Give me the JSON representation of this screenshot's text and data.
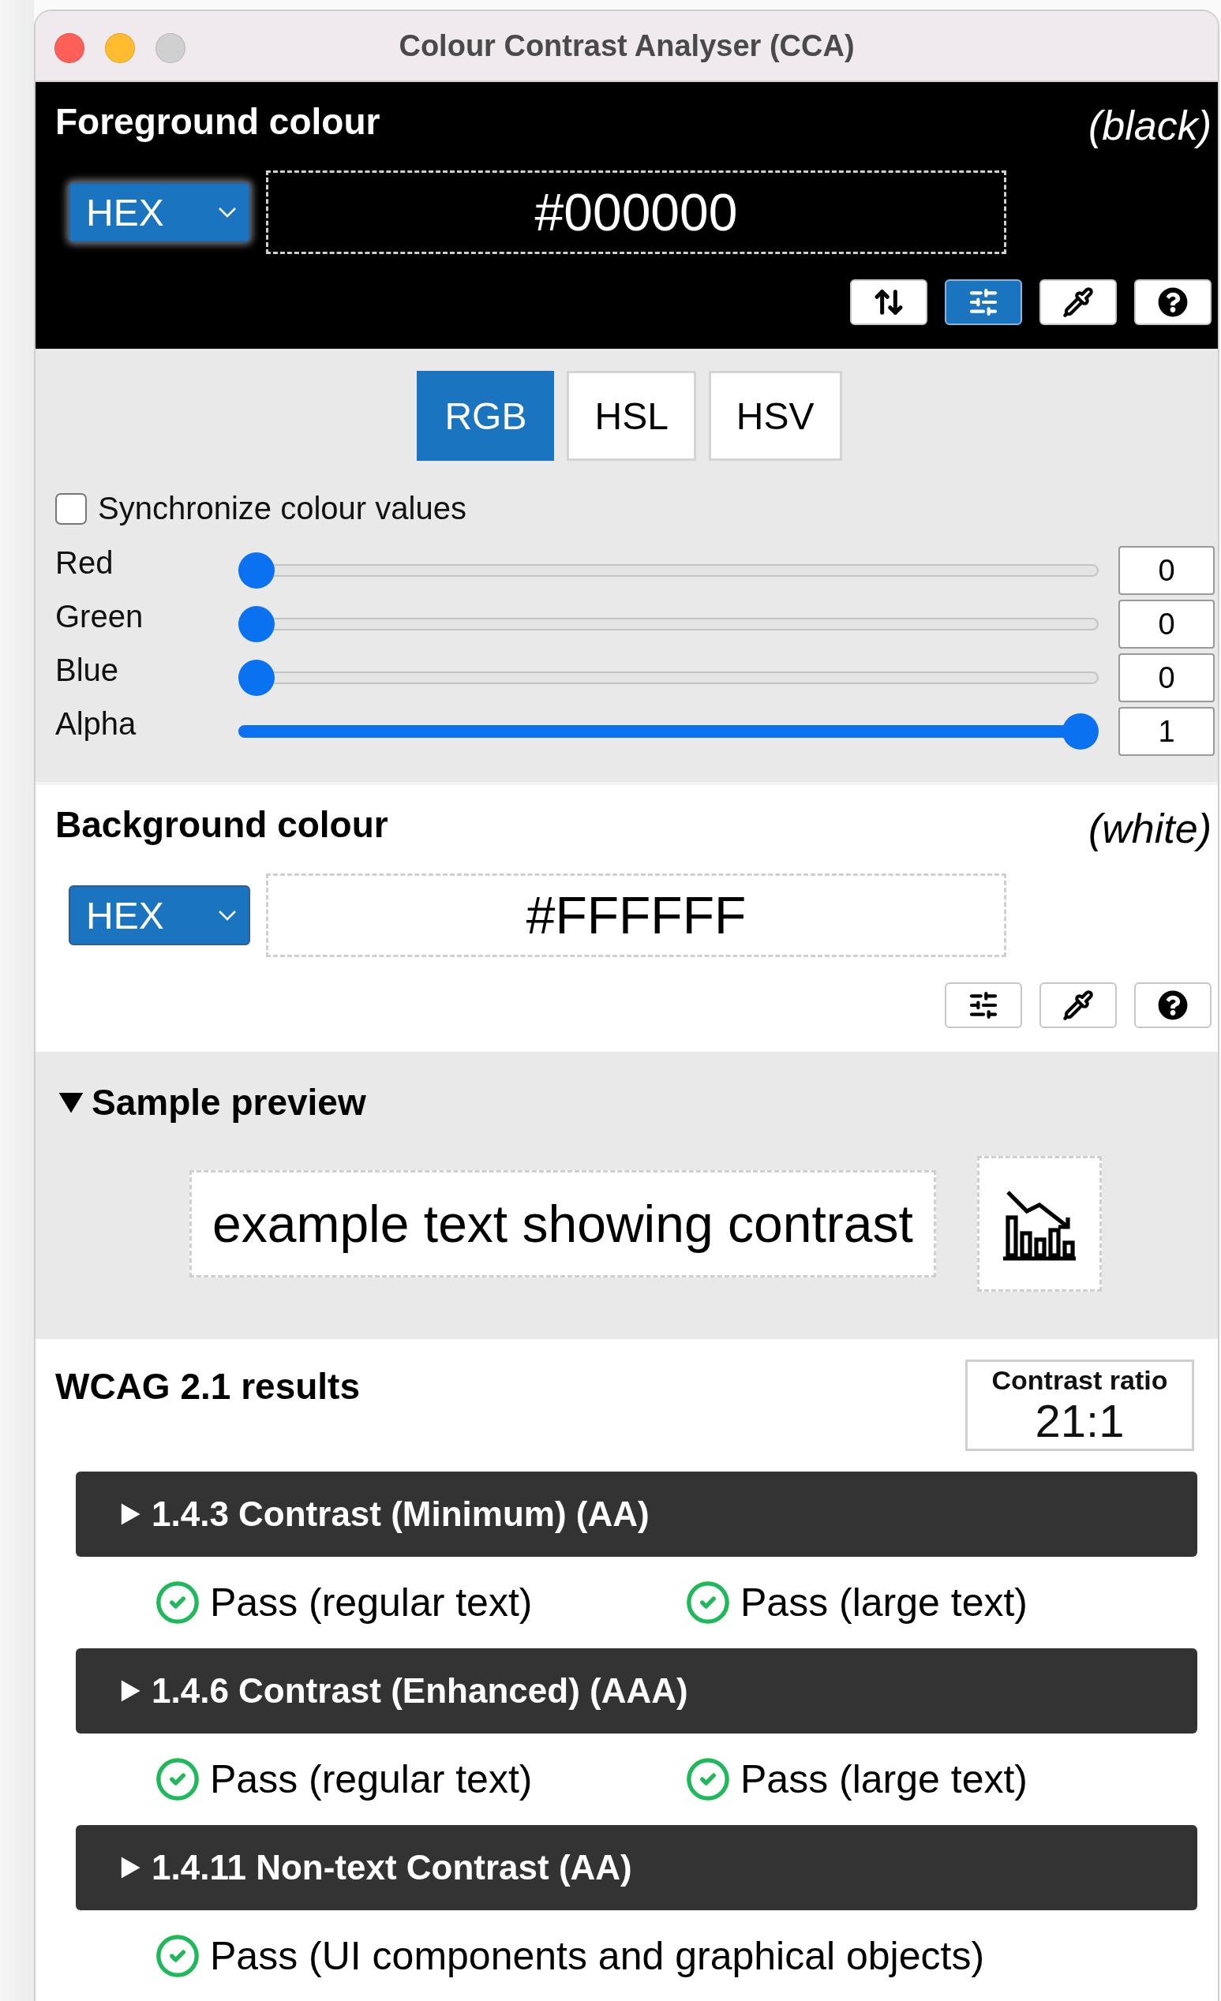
{
  "window": {
    "title": "Colour Contrast Analyser (CCA)"
  },
  "foreground": {
    "heading": "Foreground colour",
    "colour_name": "(black)",
    "format": "HEX",
    "value": "#000000",
    "tools": [
      {
        "kind": "swap",
        "selected": false
      },
      {
        "kind": "sliders",
        "selected": true
      },
      {
        "kind": "eyedropper",
        "selected": false
      },
      {
        "kind": "help",
        "selected": false
      }
    ]
  },
  "colour_model_tabs": [
    {
      "label": "RGB",
      "selected": true
    },
    {
      "label": "HSL",
      "selected": false
    },
    {
      "label": "HSV",
      "selected": false
    }
  ],
  "sync": {
    "label": "Synchronize colour values",
    "checked": false
  },
  "channels": [
    {
      "name": "Red",
      "level": 0,
      "value": "0"
    },
    {
      "name": "Green",
      "level": 0,
      "value": "0"
    },
    {
      "name": "Blue",
      "level": 0,
      "value": "0"
    },
    {
      "name": "Alpha",
      "level": 1,
      "value": "1"
    }
  ],
  "background": {
    "heading": "Background colour",
    "colour_name": "(white)",
    "format": "HEX",
    "value": "#FFFFFF",
    "tools": [
      {
        "kind": "sliders",
        "selected": false
      },
      {
        "kind": "eyedropper",
        "selected": false
      },
      {
        "kind": "help",
        "selected": false
      }
    ]
  },
  "sample_preview": {
    "heading": "Sample preview",
    "expanded": true,
    "text": "example text showing contrast"
  },
  "results": {
    "heading": "WCAG 2.1 results",
    "ratio_label": "Contrast ratio",
    "ratio": "21:1",
    "criteria": [
      {
        "title": "1.4.3 Contrast (Minimum) (AA)",
        "expanded": false,
        "checks": [
          {
            "label": "Pass (regular text)",
            "pass": true
          },
          {
            "label": "Pass (large text)",
            "pass": true
          }
        ]
      },
      {
        "title": "1.4.6 Contrast (Enhanced) (AAA)",
        "expanded": false,
        "checks": [
          {
            "label": "Pass (regular text)",
            "pass": true
          },
          {
            "label": "Pass (large text)",
            "pass": true
          }
        ]
      },
      {
        "title": "1.4.11 Non-text Contrast (AA)",
        "expanded": false,
        "checks": [
          {
            "label": "Pass (UI components and graphical objects)",
            "pass": true
          }
        ]
      }
    ]
  }
}
